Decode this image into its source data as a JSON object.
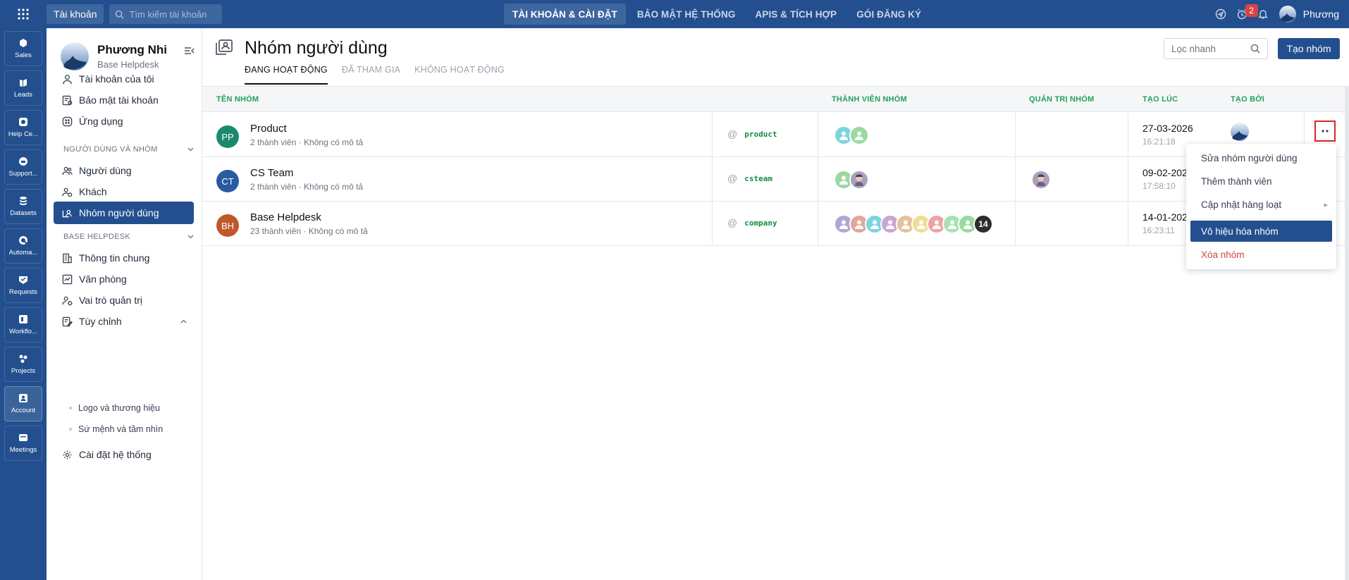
{
  "topbar": {
    "account_btn": "Tài khoản",
    "search_placeholder": "Tìm kiếm tài khoản",
    "nav": [
      "TÀI KHOẢN & CÀI ĐẶT",
      "BẢO MẬT HỆ THỐNG",
      "APIS & TÍCH HỢP",
      "GÓI ĐĂNG KÝ"
    ],
    "notification_count": "2",
    "user": "Phương"
  },
  "rail": [
    "Sales",
    "Leads",
    "Help Ce...",
    "Support...",
    "Datasets",
    "Automa...",
    "Requests",
    "Workflo...",
    "Projects",
    "Account",
    "Meetings"
  ],
  "sidebar": {
    "name": "Phương Nhi",
    "org": "Base Helpdesk",
    "items_top": [
      "Tài khoản của tôi",
      "Bảo mật tài khoản",
      "Ứng dụng"
    ],
    "section1": "NGƯỜI DÙNG VÀ NHÓM",
    "items_s1": [
      "Người dùng",
      "Khách",
      "Nhóm người dùng"
    ],
    "section2": "BASE HELPDESK",
    "items_s2": [
      "Thông tin chung",
      "Văn phòng",
      "Vai trò quản trị",
      "Tùy chỉnh"
    ],
    "subitems": [
      "Logo và thương hiệu",
      "Sứ mệnh và tầm nhìn"
    ],
    "item_last": "Cài đặt hệ thống"
  },
  "page": {
    "title": "Nhóm người dùng",
    "tabs": [
      "ĐANG HOẠT ĐỘNG",
      "ĐÃ THAM GIA",
      "KHÔNG HOẠT ĐỘNG"
    ],
    "quick_filter": "Lọc nhanh",
    "create_btn": "Tạo nhóm"
  },
  "table": {
    "headers": [
      "TÊN NHÓM",
      "THÀNH VIÊN NHÓM",
      "QUẢN TRỊ NHÓM",
      "TẠO LÚC",
      "TẠO BỞI"
    ],
    "rows": [
      {
        "initials": "PP",
        "name": "Product",
        "sub": "2 thành viên · Không có mô tả",
        "alias": "product",
        "date": "27-03-2026",
        "time": "16:21:18",
        "color": "#1a8a6e",
        "members": 2
      },
      {
        "initials": "CT",
        "name": "CS Team",
        "sub": "2 thành viên · Không có mô tả",
        "alias": "csteam",
        "date": "09-02-202",
        "time": "17:58:10",
        "color": "#2a5aa0",
        "members": 2
      },
      {
        "initials": "BH",
        "name": "Base Helpdesk",
        "sub": "23 thành viên · Không có mô tả",
        "alias": "company",
        "date": "14-01-202",
        "time": "16:23:11",
        "color": "#c0582b",
        "members": 8,
        "more_count": "14"
      }
    ]
  },
  "menu": [
    "Sửa nhóm người dùng",
    "Thêm thành viên",
    "Cập nhật hàng loạt",
    "Vô hiệu hóa nhóm",
    "Xóa nhóm"
  ]
}
